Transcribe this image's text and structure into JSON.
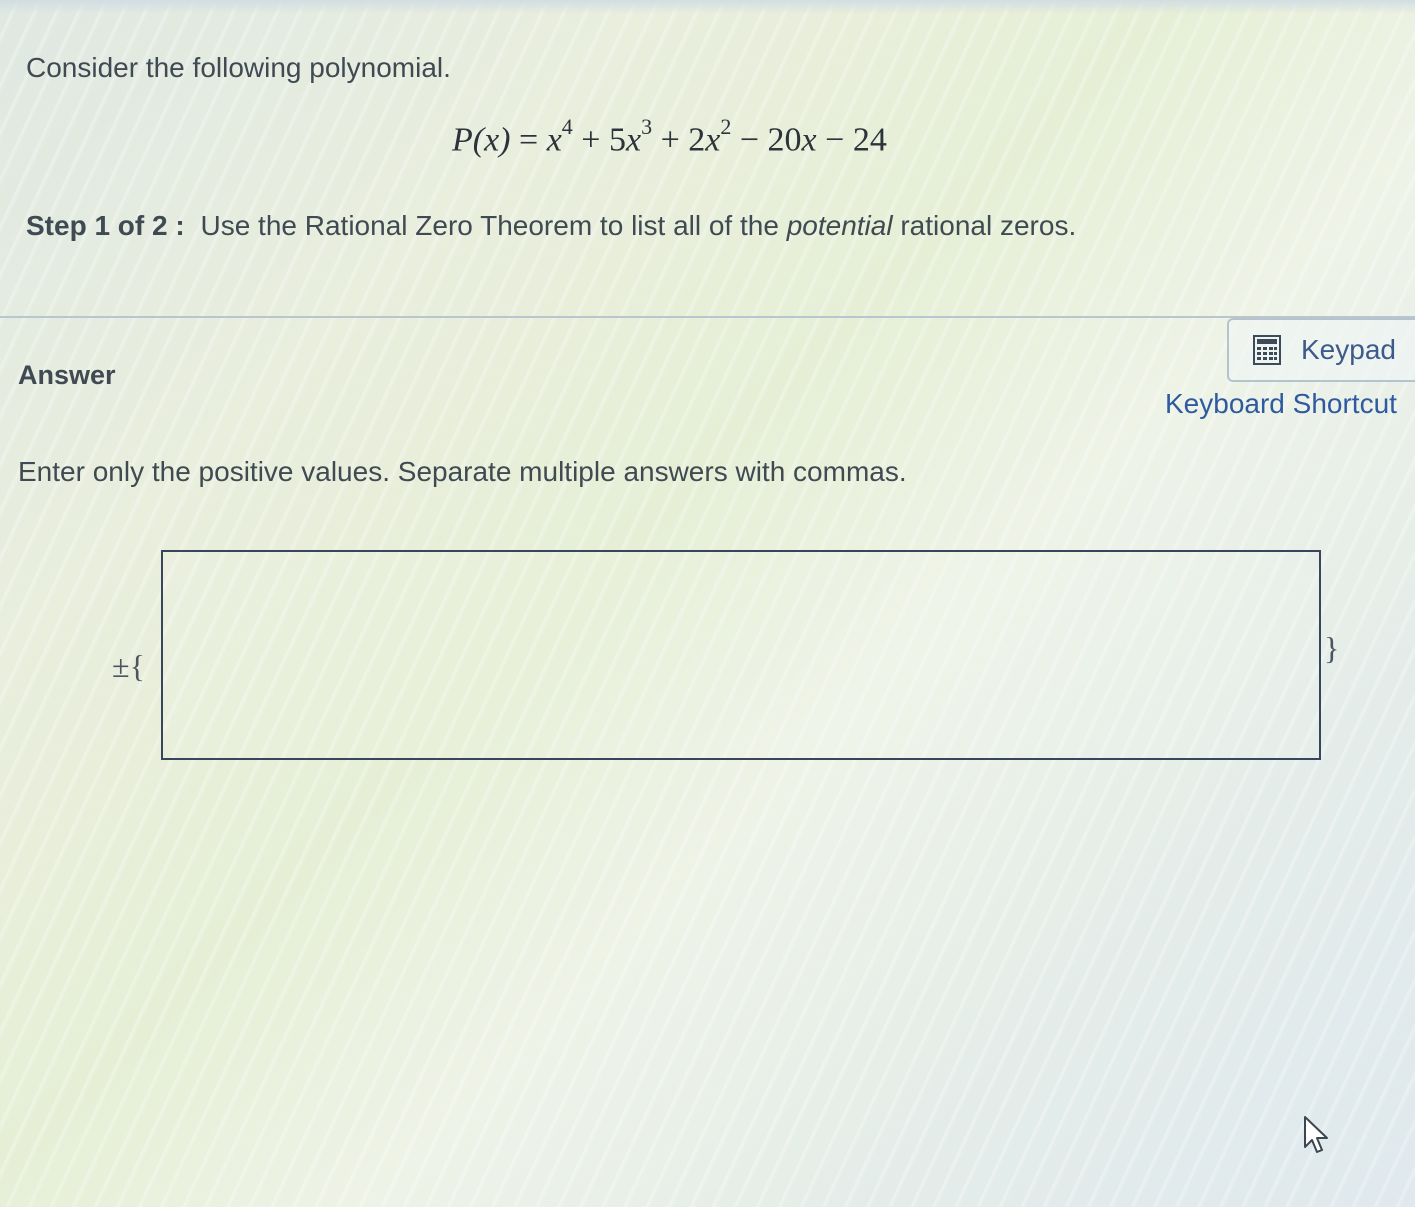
{
  "question": {
    "intro": "Consider the following polynomial.",
    "equation": {
      "lhs": "P(x)",
      "equals": "=",
      "t1_base": "x",
      "t1_exp": "4",
      "op1": "+",
      "t2_coef": "5",
      "t2_base": "x",
      "t2_exp": "3",
      "op2": "+",
      "t3_coef": "2",
      "t3_base": "x",
      "t3_exp": "2",
      "op3": "−",
      "t4_coef": "20",
      "t4_base": "x",
      "op4": "−",
      "t5": "24"
    },
    "step_label": "Step 1 of 2 :",
    "step_text_before": "Use the Rational Zero Theorem to list all of the",
    "step_text_emphasis": "potential",
    "step_text_after": "rational zeros."
  },
  "answer": {
    "heading": "Answer",
    "keypad_label": "Keypad",
    "keyboard_shortcuts_label": "Keyboard Shortcut",
    "instruction": "Enter only the positive values. Separate multiple answers with commas.",
    "prefix": "±{",
    "suffix": "}",
    "input_value": ""
  },
  "icons": {
    "keypad": "calculator-icon",
    "cursor": "mouse-pointer-icon"
  }
}
